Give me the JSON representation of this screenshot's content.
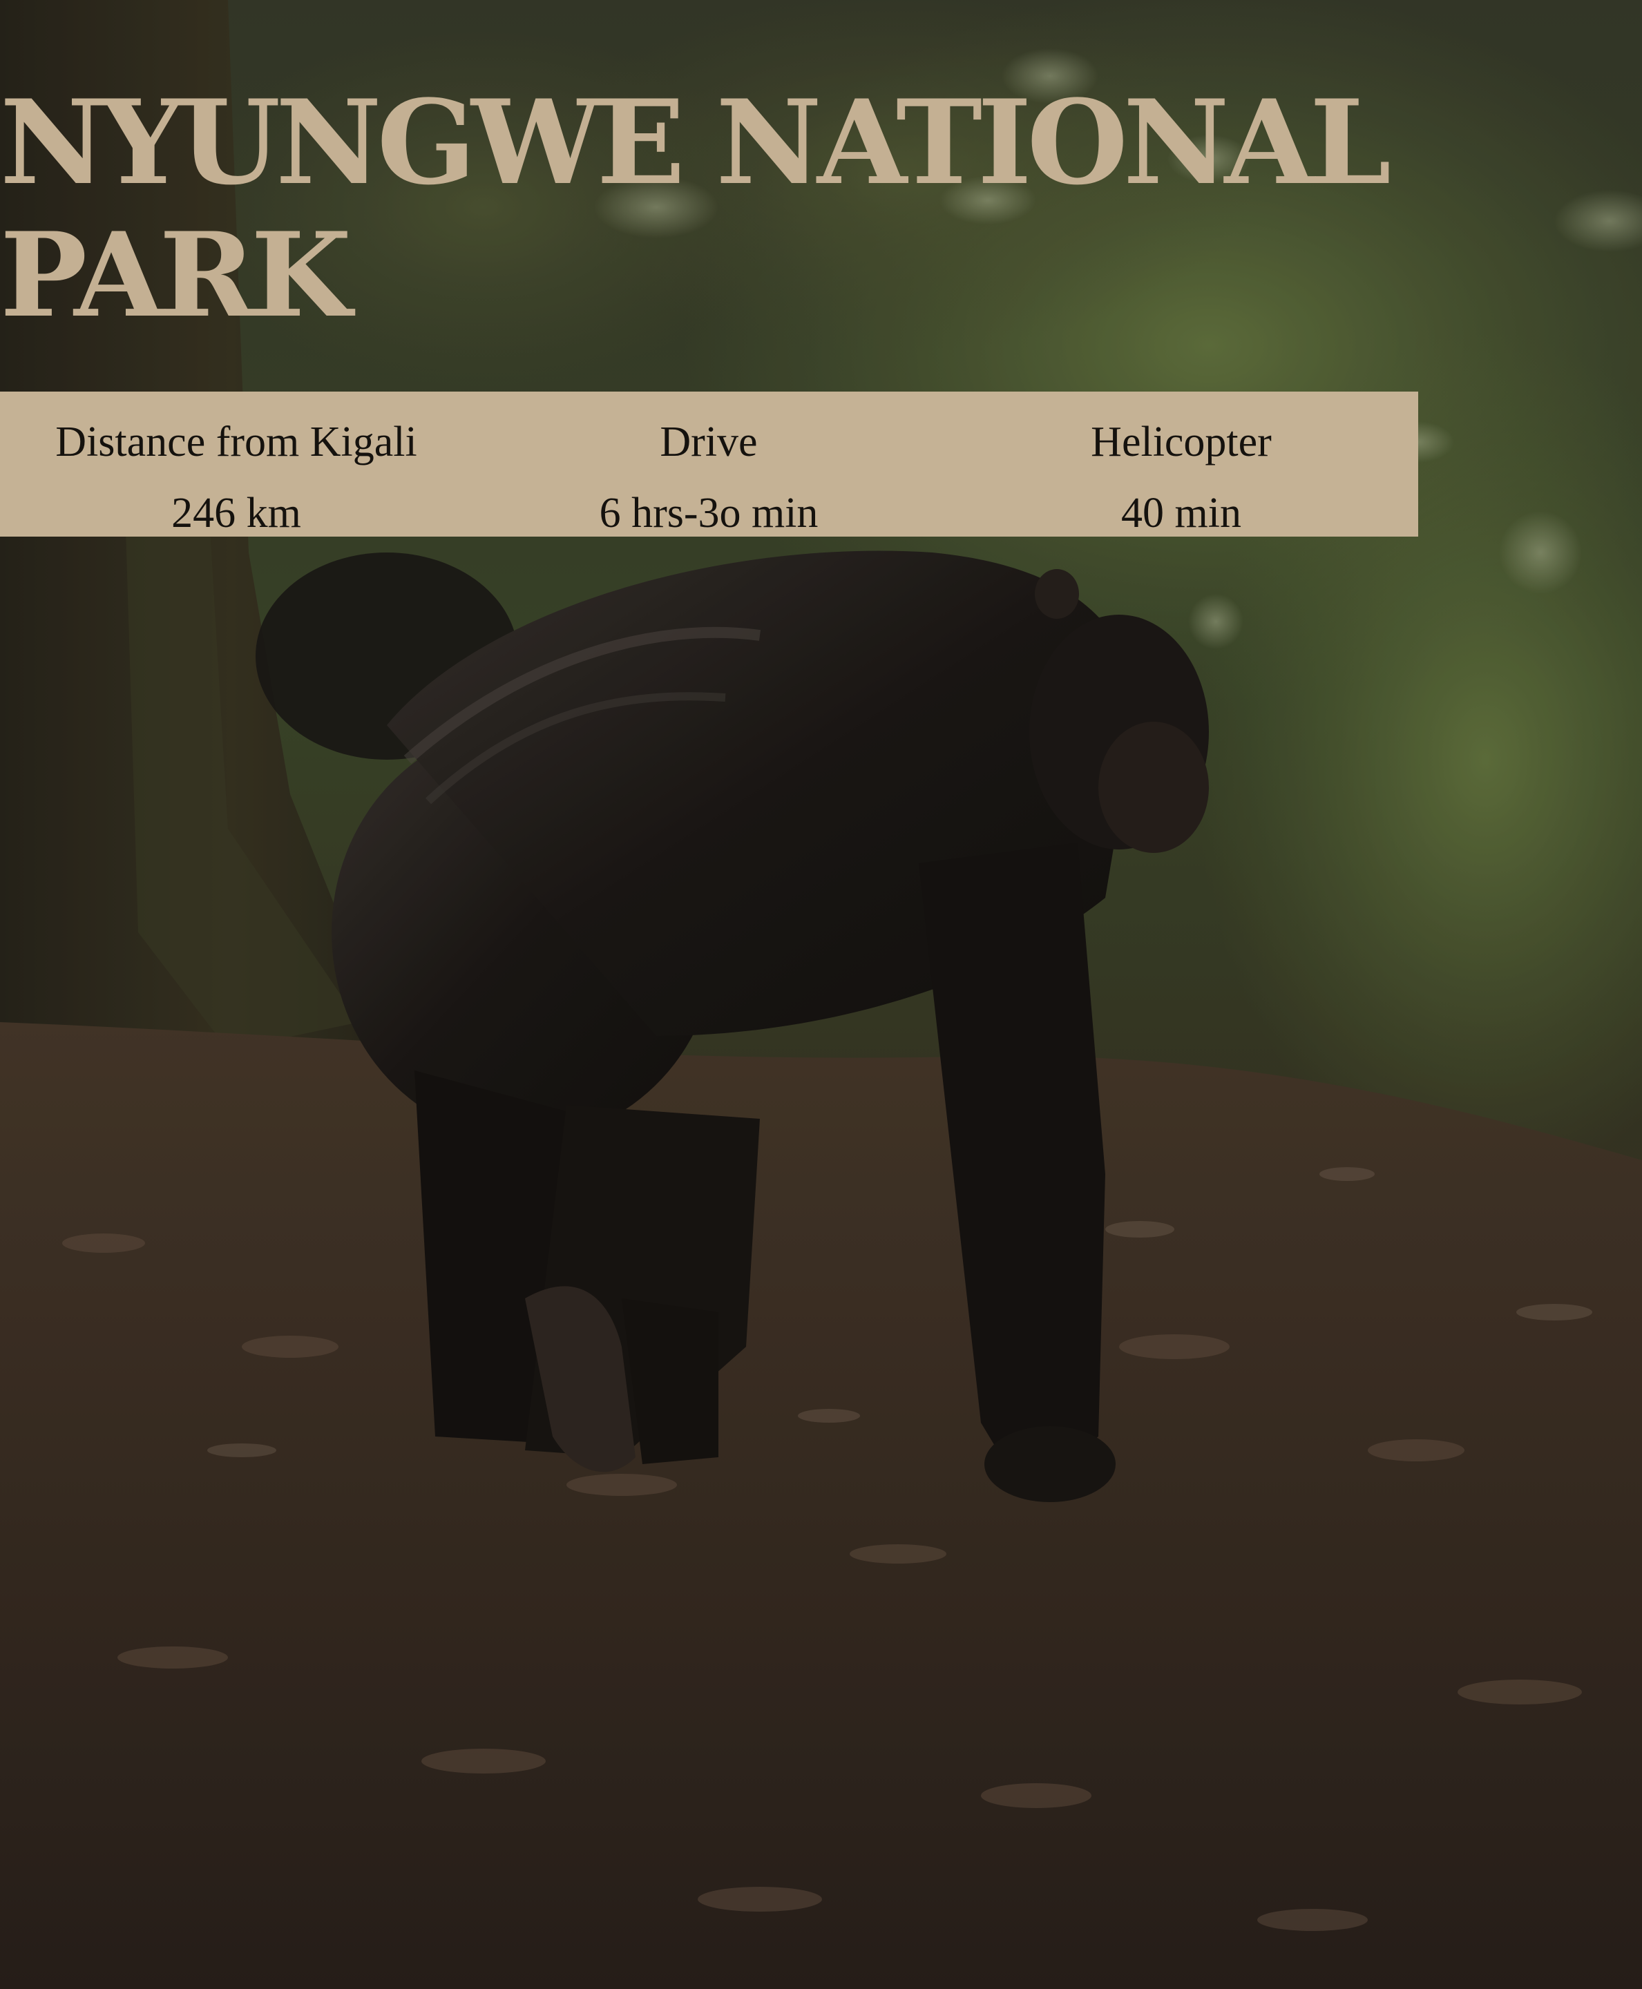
{
  "page": {
    "title_lines": [
      "NYUNGWE NATIONAL",
      "PARK"
    ]
  },
  "photo": {
    "subject": "chimpanzee-walking-on-forest-trail"
  },
  "info": {
    "columns": [
      {
        "label": "Distance from Kigali",
        "value": "246 km"
      },
      {
        "label": "Drive",
        "value": "6 hrs-3o min"
      },
      {
        "label": "Helicopter",
        "value": "40 min"
      }
    ]
  },
  "colors": {
    "title": "#c4b093",
    "band": "#c5b295",
    "band_text": "#15120e"
  }
}
